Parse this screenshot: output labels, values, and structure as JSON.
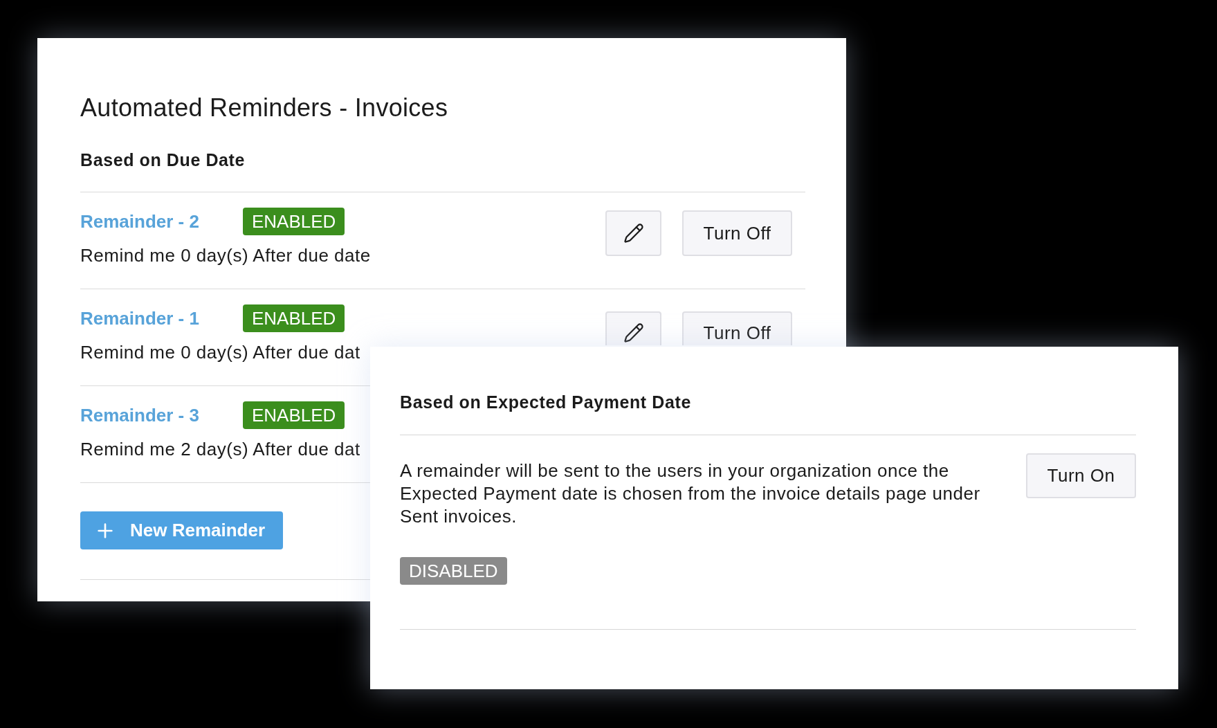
{
  "invoices_panel": {
    "title": "Automated Reminders - Invoices",
    "section_title": "Based on Due Date",
    "reminders": [
      {
        "name": "Remainder - 2",
        "status": "ENABLED",
        "enabled": true,
        "description": "Remind me 0 day(s) After due date",
        "toggle_label": "Turn Off"
      },
      {
        "name": "Remainder - 1",
        "status": "ENABLED",
        "enabled": true,
        "description": "Remind me 0 day(s) After due dat",
        "toggle_label": "Turn Off"
      },
      {
        "name": "Remainder - 3",
        "status": "ENABLED",
        "enabled": true,
        "description": "Remind me 2 day(s) After due dat"
      }
    ],
    "new_reminder_button": "New Remainder"
  },
  "expected_payment_panel": {
    "section_title": "Based on Expected Payment Date",
    "description": "A remainder will be sent to the users in your organization once the Expected Payment date is chosen from the invoice details page under Sent invoices.",
    "toggle_label": "Turn On",
    "status": "DISABLED",
    "enabled": false
  }
}
